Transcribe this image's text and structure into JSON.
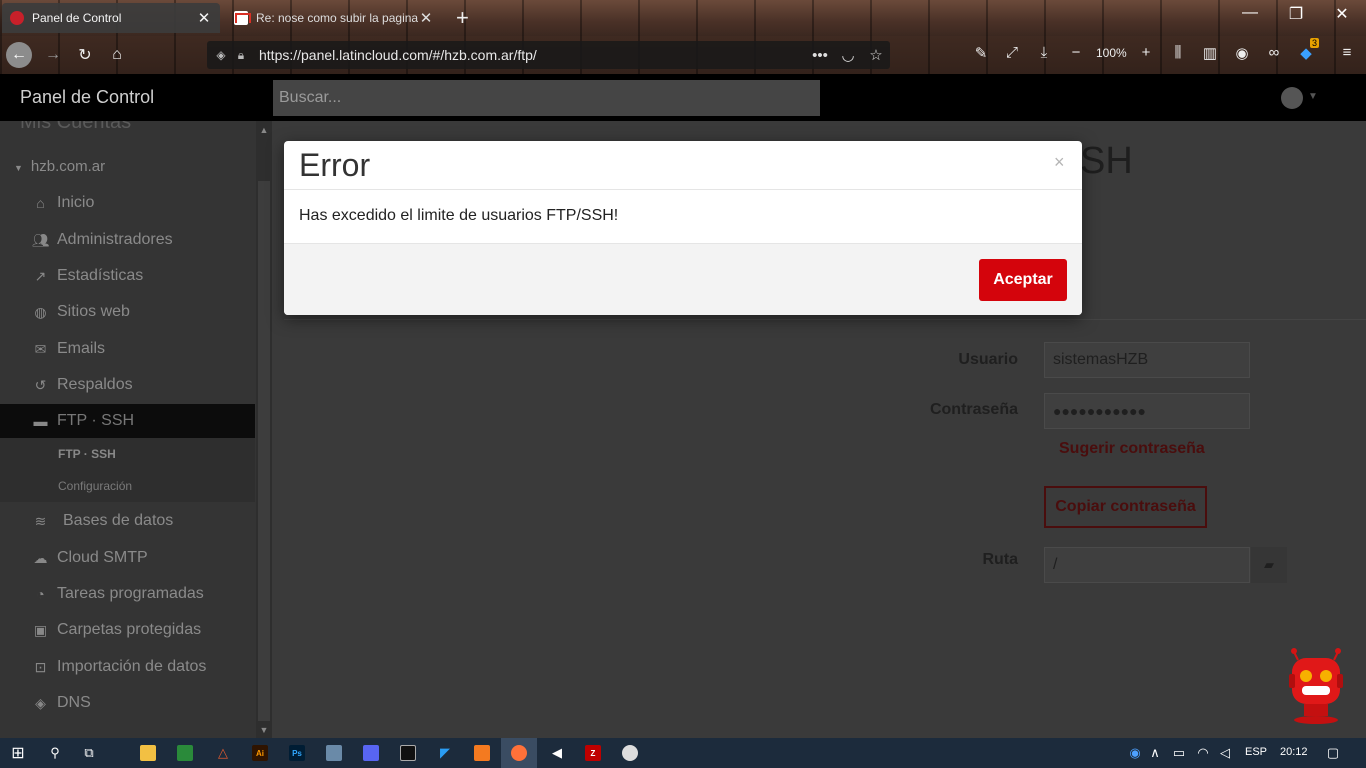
{
  "browser": {
    "tabs": [
      {
        "title": "Panel de Control",
        "active": true
      },
      {
        "title": "Re: nose como subir la pagina",
        "active": false
      }
    ],
    "new_tab": "+",
    "url": "https://panel.latincloud.com/#/hzb.com.ar/ftp/",
    "zoom": "100%",
    "notification_count": "3",
    "window_controls": {
      "minimize": "—",
      "restore": "❐",
      "close": "✕"
    }
  },
  "app": {
    "brand": "Panel de Control",
    "search_placeholder": "Buscar..."
  },
  "sidebar": {
    "section_partial": "Mis Cuentas",
    "account": "hzb.com.ar",
    "items": [
      {
        "label": "Inicio",
        "icon": "home-icon"
      },
      {
        "label": "Administradores",
        "icon": "users-icon"
      },
      {
        "label": "Estadísticas",
        "icon": "trend-icon"
      },
      {
        "label": "Sitios web",
        "icon": "globe-icon"
      },
      {
        "label": "Emails",
        "icon": "mail-icon"
      },
      {
        "label": "Respaldos",
        "icon": "restore-icon"
      },
      {
        "label": "FTP · SSH",
        "icon": "folder-icon",
        "active": true
      },
      {
        "label": "Bases de datos",
        "icon": "database-icon"
      },
      {
        "label": "Cloud SMTP",
        "icon": "cloud-upload-icon"
      },
      {
        "label": "Tareas programadas",
        "icon": "clock-icon"
      },
      {
        "label": "Carpetas protegidas",
        "icon": "lock-icon"
      },
      {
        "label": "Importación de datos",
        "icon": "import-icon"
      },
      {
        "label": "DNS",
        "icon": "compass-icon"
      }
    ],
    "subitems": [
      {
        "label": "FTP · SSH",
        "current": true
      },
      {
        "label": "Configuración",
        "current": false
      }
    ]
  },
  "main": {
    "title_fragment": "SH",
    "form": {
      "user_label": "Usuario",
      "user_value": "sistemasHZB",
      "password_label": "Contraseña",
      "password_value": "●●●●●●●●●●●",
      "suggest_link": "Sugerir contraseña",
      "copy_button": "Copiar contraseña",
      "path_label": "Ruta",
      "path_value": "/"
    }
  },
  "modal": {
    "title": "Error",
    "close": "×",
    "message": "Has excedido el limite de usuarios FTP/SSH!",
    "ok_button": "Aceptar"
  },
  "taskbar": {
    "language": "ESP",
    "time": "20:12"
  },
  "colors": {
    "accent": "#d4040c",
    "header": "#000000",
    "sidebar_bg": "#343434",
    "taskbar": "#1c2b3c"
  }
}
